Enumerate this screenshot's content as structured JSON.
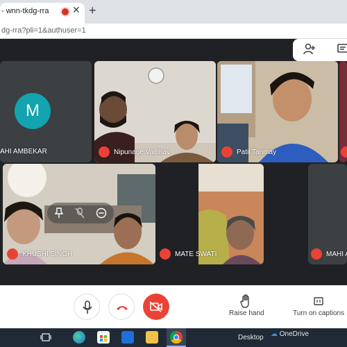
{
  "browser": {
    "tab_title": "- wnn-tkdg-rra",
    "tab_close": "✕",
    "new_tab": "+",
    "address": "dg-rra?pli=1&authuser=1"
  },
  "participants": [
    {
      "name": "AHI AMBEKAR",
      "avatar_letter": "M"
    },
    {
      "name": "Nipunage Vaibhav"
    },
    {
      "name": "Patil Tanmay"
    },
    {
      "name": "KHUSHI SINGH"
    },
    {
      "name": "MATE SWATI"
    },
    {
      "name": "MAHI A"
    }
  ],
  "controls": {
    "raise_hand": "Raise hand",
    "captions": "Turn on captions"
  },
  "taskbar": {
    "desktop": "Desktop",
    "onedrive": "OneDrive"
  },
  "colors": {
    "stage": "#202124",
    "mute_red": "#ea4335",
    "avatar_teal": "#12a4af"
  }
}
